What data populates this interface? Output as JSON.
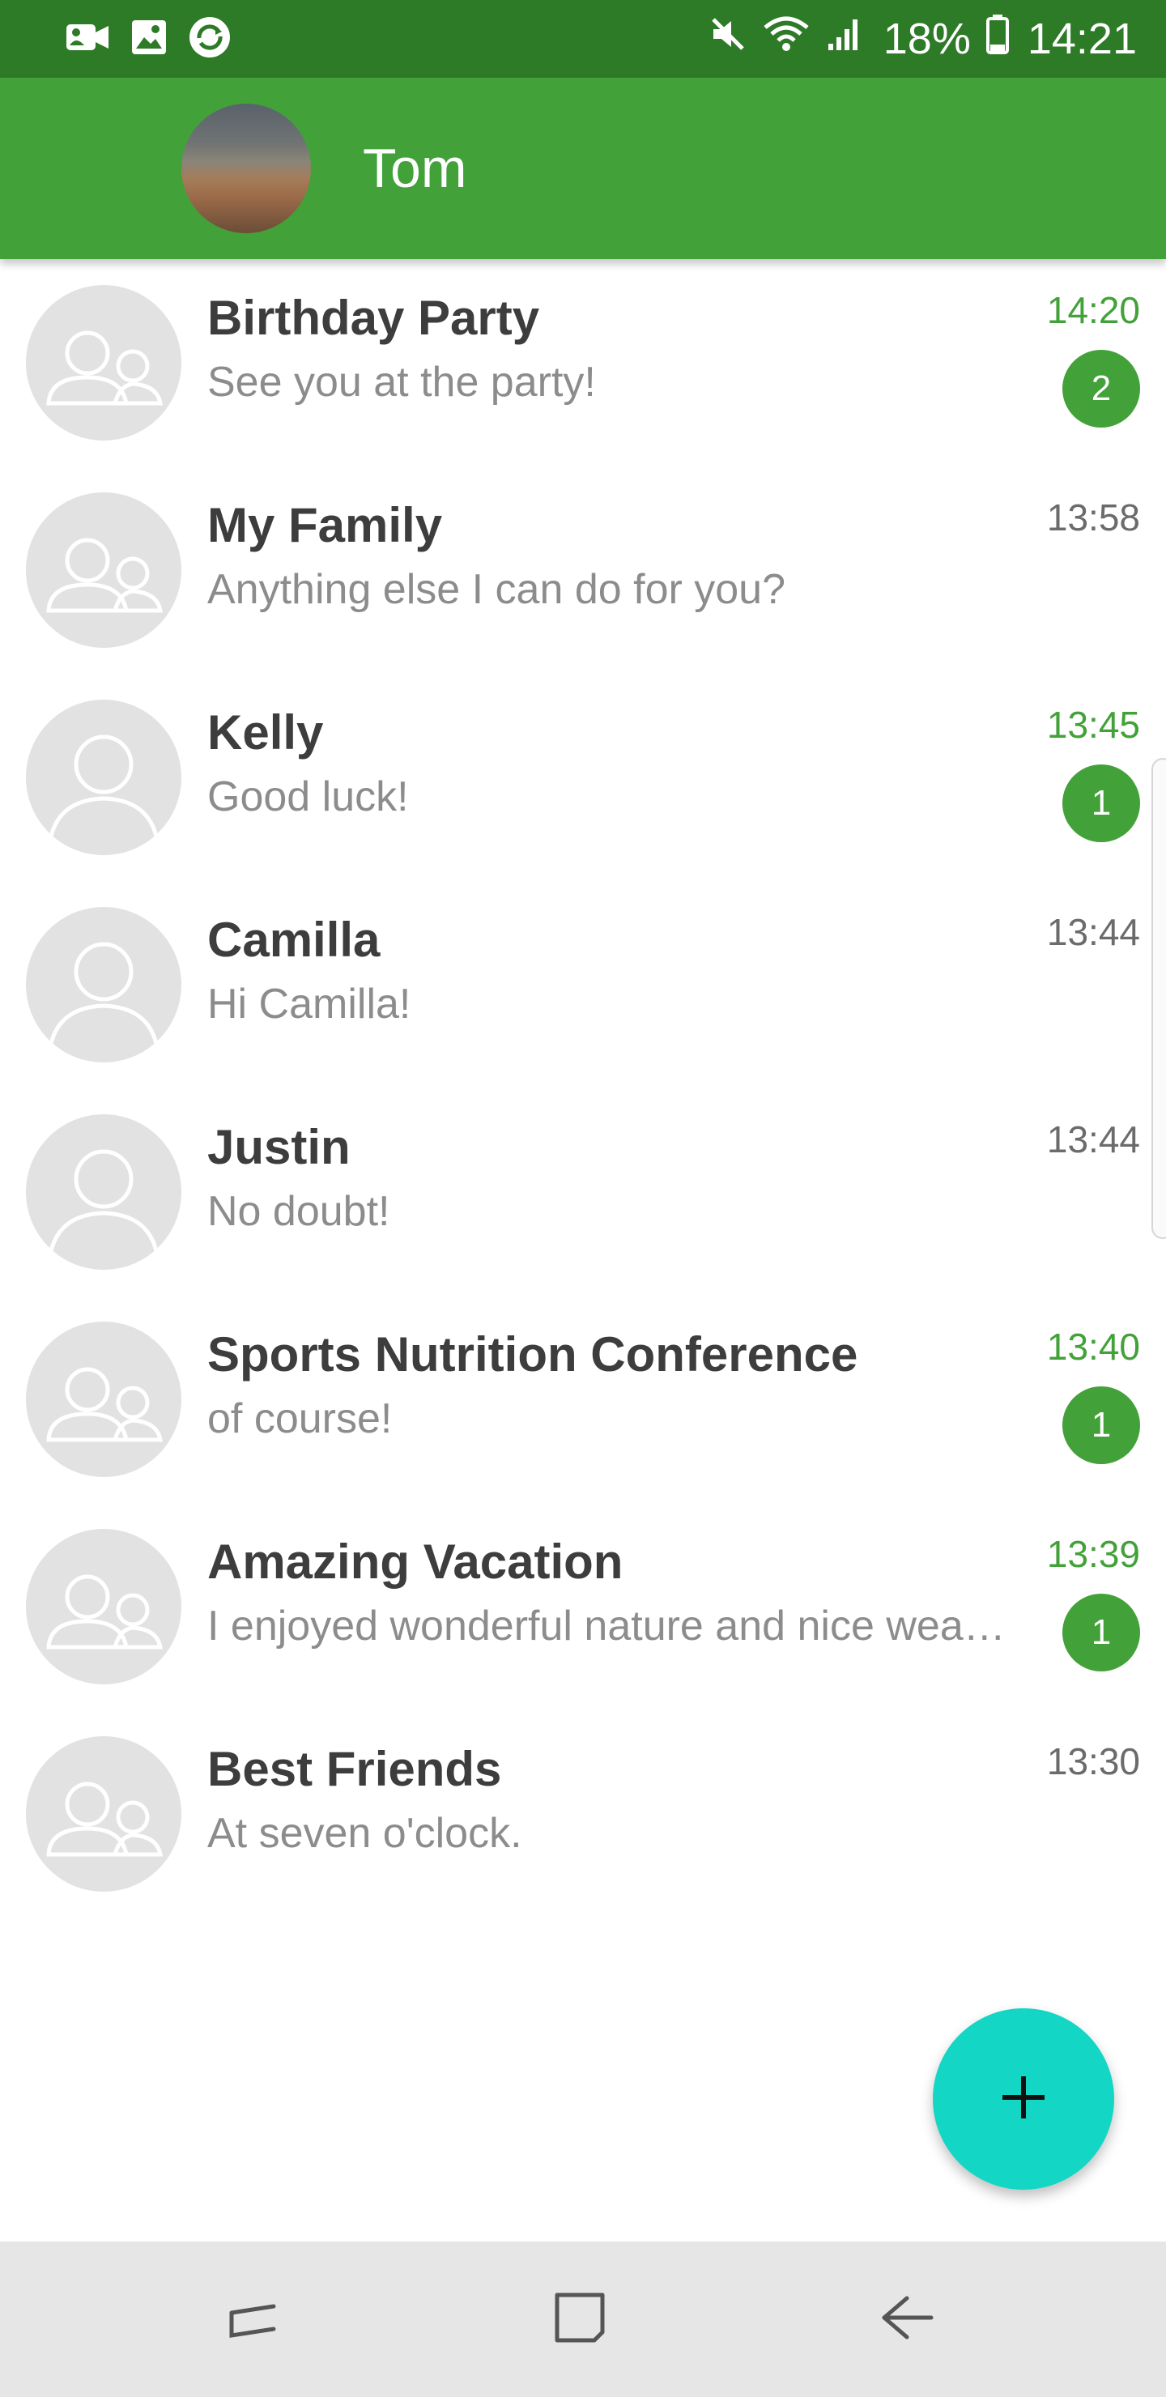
{
  "status_bar": {
    "battery_percent": "18%",
    "time": "14:21",
    "left_icons": [
      "video-call-icon",
      "gallery-icon",
      "sync-icon"
    ],
    "right_icons": [
      "mute-icon",
      "wifi-icon",
      "signal-icon",
      "battery-icon"
    ]
  },
  "header": {
    "name": "Tom",
    "avatar_icon": "profile-photo"
  },
  "colors": {
    "status_bar": "#2d7a27",
    "app_bar": "#43a13a",
    "accent_green": "#43a13a",
    "fab": "#13d6c5",
    "avatar_placeholder": "#e2e2e2",
    "nav_bar": "#e6e6e6"
  },
  "chats": [
    {
      "title": "Birthday Party",
      "preview": "See you at the party!",
      "time": "14:20",
      "unread": "2",
      "type": "group"
    },
    {
      "title": "My Family",
      "preview": "Anything else I can do for you?",
      "time": "13:58",
      "unread": "",
      "type": "group"
    },
    {
      "title": "Kelly",
      "preview": "Good luck!",
      "time": "13:45",
      "unread": "1",
      "type": "person"
    },
    {
      "title": "Camilla",
      "preview": "Hi Camilla!",
      "time": "13:44",
      "unread": "",
      "type": "person"
    },
    {
      "title": "Justin",
      "preview": "No doubt!",
      "time": "13:44",
      "unread": "",
      "type": "person"
    },
    {
      "title": "Sports Nutrition Conference",
      "preview": "of course!",
      "time": "13:40",
      "unread": "1",
      "type": "group"
    },
    {
      "title": "Amazing Vacation",
      "preview": "I enjoyed wonderful nature and nice wea…",
      "time": "13:39",
      "unread": "1",
      "type": "group"
    },
    {
      "title": "Best Friends",
      "preview": "At seven o'clock.",
      "time": "13:30",
      "unread": "",
      "type": "group"
    }
  ],
  "fab": {
    "icon": "plus-icon"
  },
  "nav_bar": {
    "buttons": [
      "recent-apps-icon",
      "home-icon",
      "back-icon"
    ]
  }
}
